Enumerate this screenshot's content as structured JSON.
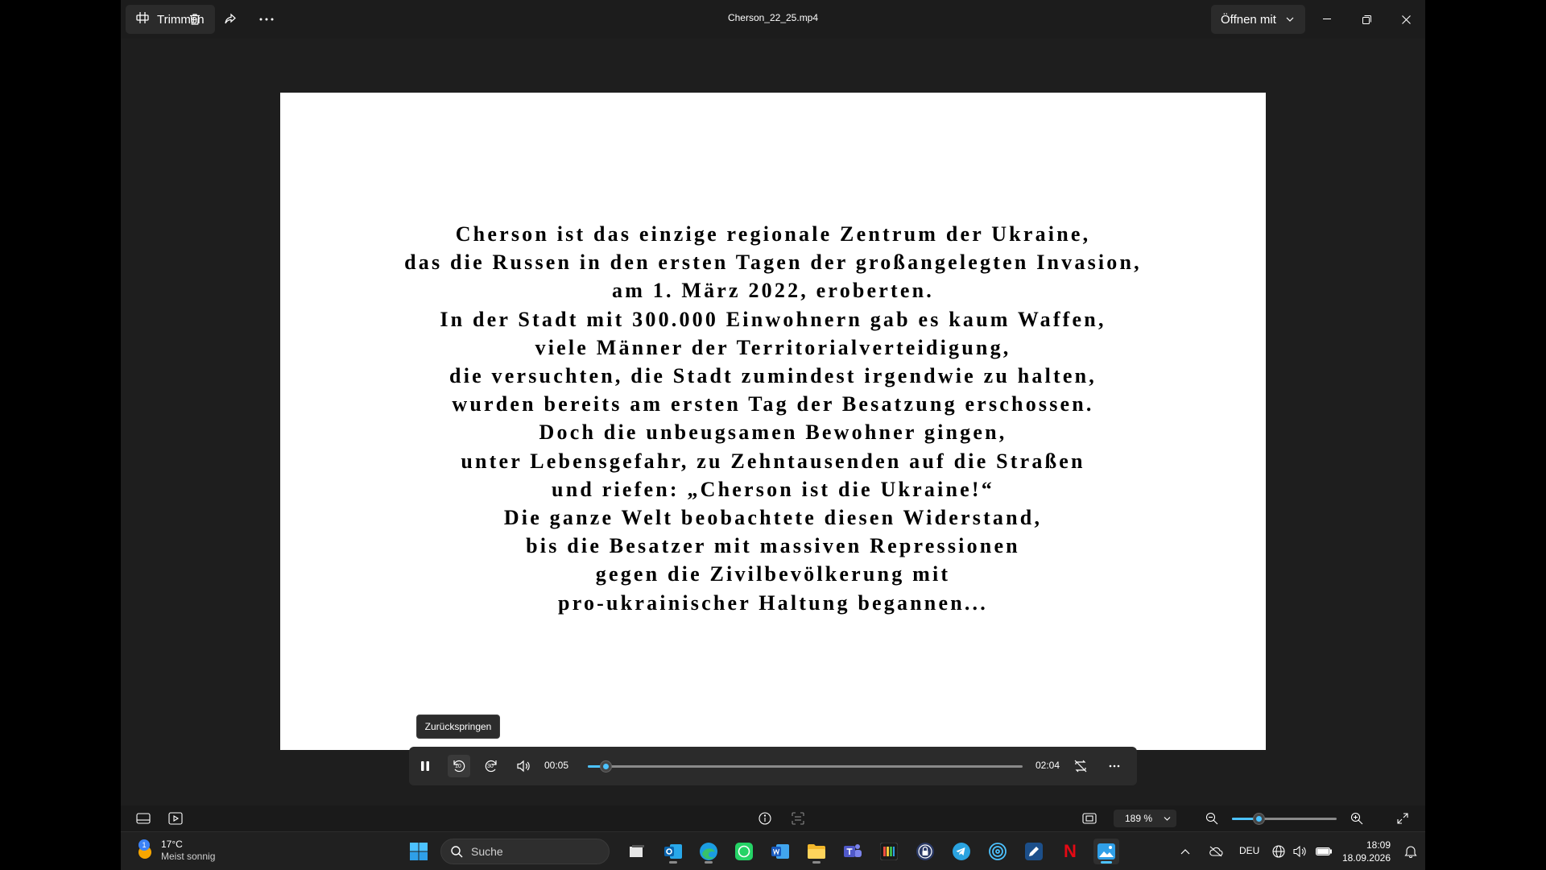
{
  "titlebar": {
    "trim_label": "Trimmen",
    "file_name": "Cherson_22_25.mp4",
    "open_with_label": "Öffnen mit"
  },
  "video": {
    "lines": [
      "Cherson ist das einzige regionale Zentrum der Ukraine,",
      "das die Russen in den ersten Tagen der großangelegten Invasion,",
      "am 1. März 2022, eroberten.",
      "In der Stadt mit 300.000 Einwohnern gab es kaum Waffen,",
      "viele Männer der Territorialverteidigung,",
      "die versuchten, die Stadt zumindest irgendwie zu halten,",
      "wurden bereits am ersten Tag der Besatzung erschossen.",
      "Doch die unbeugsamen Bewohner gingen,",
      "unter Lebensgefahr, zu Zehntausenden auf die Straßen",
      "und riefen: „Cherson ist die Ukraine!“",
      "Die ganze Welt beobachtete diesen Widerstand,",
      "bis die Besatzer mit massiven Repressionen",
      "gegen die Zivilbevölkerung mit",
      "pro-ukrainischer Haltung begannen..."
    ]
  },
  "tooltip": {
    "text": "Zurückspringen"
  },
  "controls": {
    "skip_back_seconds": "10",
    "skip_forward_seconds": "30",
    "current_time": "00:05",
    "total_time": "02:04",
    "progress_fraction": 0.04
  },
  "bottombar": {
    "zoom_level": "189 %",
    "zoom_fraction": 0.25
  },
  "taskbar": {
    "weather_badge": "1",
    "weather_temp": "17°C",
    "weather_desc": "Meist sonnig",
    "search_placeholder": "Suche",
    "language": "DEU",
    "time": "18:09",
    "date": "18.09.2026",
    "netflix_letter": "N"
  },
  "colors": {
    "accent": "#4cc2ff",
    "window_bg": "#1c1c1c",
    "taskbar_bg": "#202020"
  }
}
